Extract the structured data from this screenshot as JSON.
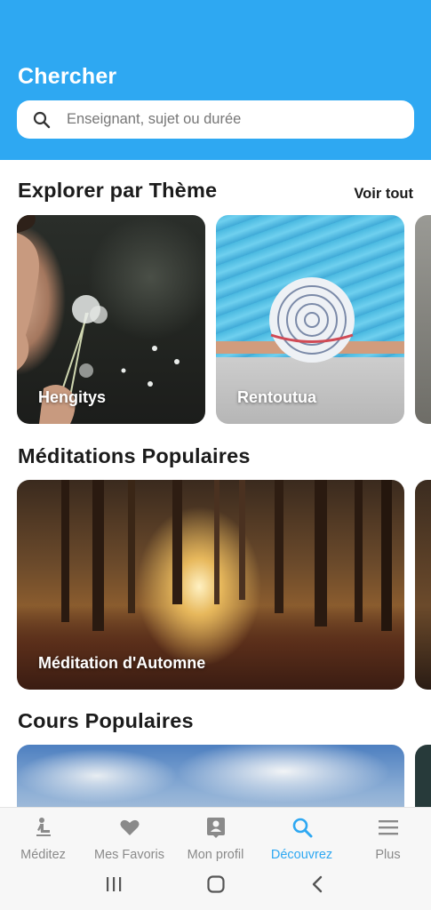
{
  "header": {
    "title": "Chercher",
    "search": {
      "placeholder": "Enseignant, sujet ou durée",
      "icon": "search-icon"
    },
    "background_color": "#2ea8f2"
  },
  "themes": {
    "title": "Explorer par Thème",
    "see_all": "Voir tout",
    "cards": [
      {
        "label": "Hengitys"
      },
      {
        "label": "Rentoutua"
      }
    ]
  },
  "meditations": {
    "title": "Méditations Populaires",
    "cards": [
      {
        "label": "Méditation d'Automne"
      }
    ]
  },
  "courses": {
    "title": "Cours Populaires"
  },
  "tabbar": {
    "active_color": "#2ea8f2",
    "items": [
      {
        "label": "Méditez",
        "icon": "meditation-person-icon"
      },
      {
        "label": "Mes Favoris",
        "icon": "heart-icon"
      },
      {
        "label": "Mon profil",
        "icon": "profile-card-icon"
      },
      {
        "label": "Découvrez",
        "icon": "search-icon",
        "active": true
      },
      {
        "label": "Plus",
        "icon": "menu-icon"
      }
    ]
  },
  "system_nav": {
    "icons": [
      "recent-apps-icon",
      "home-icon",
      "back-icon"
    ]
  }
}
